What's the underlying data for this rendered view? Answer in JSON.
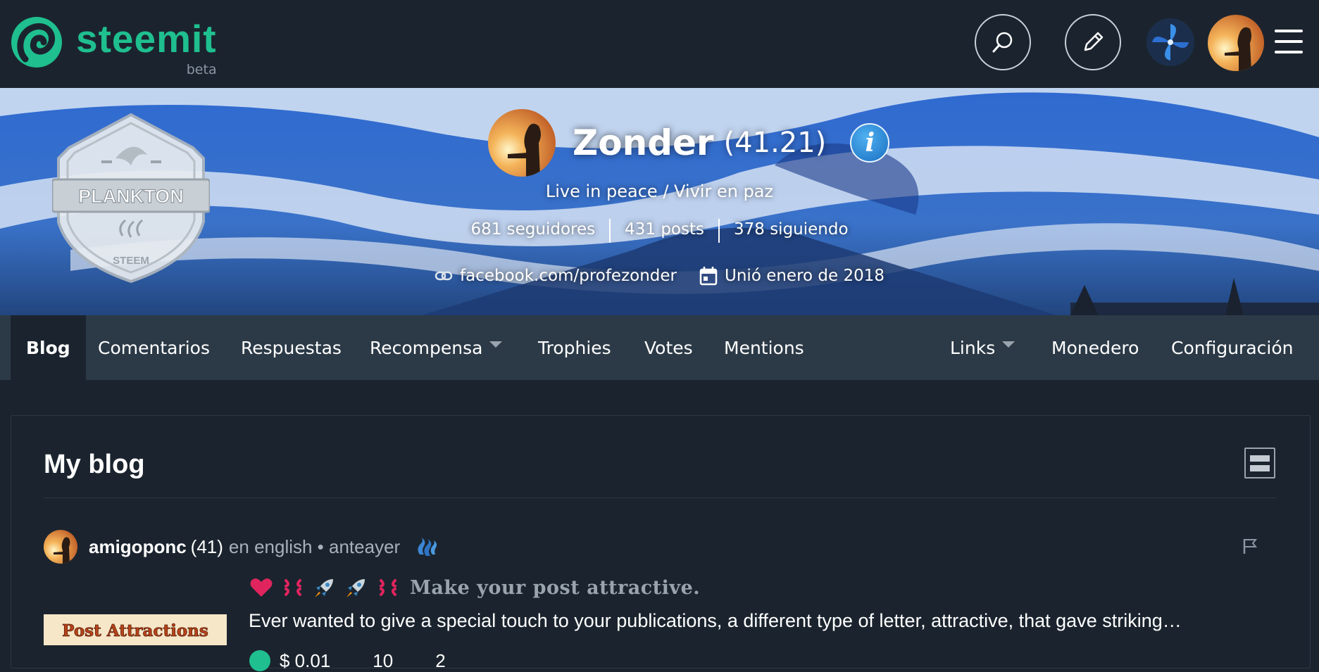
{
  "brand": {
    "name": "steemit",
    "beta": "beta",
    "accent": "#1fbf8f"
  },
  "header": {
    "icons": [
      "search-icon",
      "pencil-icon",
      "pinwheel-icon",
      "avatar",
      "hamburger-icon"
    ]
  },
  "profile": {
    "name": "Zonder",
    "reputation": "(41.21)",
    "about": "Live in peace / Vivir en paz",
    "followers": "681 seguidores",
    "posts": "431 posts",
    "following": "378 siguiendo",
    "website": "facebook.com/profezonder",
    "joined": "Unió enero de 2018",
    "badge": "PLANKTON"
  },
  "tabs": {
    "blog": "Blog",
    "comments": "Comentarios",
    "replies": "Respuestas",
    "rewards": "Recompensa",
    "trophies": "Trophies",
    "votes": "Votes",
    "mentions": "Mentions",
    "links": "Links",
    "wallet": "Monedero",
    "settings": "Configuración"
  },
  "main": {
    "title": "My blog",
    "post": {
      "author": "amigoponc",
      "author_rep": "(41)",
      "category_time": "en english • anteayer",
      "title": "Make your post attractive.",
      "description": "Ever wanted to give a special touch to your publications, a different type of letter, attractive, that gave striking…",
      "thumb_text": "Post Attractions",
      "payout": "$ 0.01",
      "votes": "10",
      "comments": "2"
    }
  }
}
